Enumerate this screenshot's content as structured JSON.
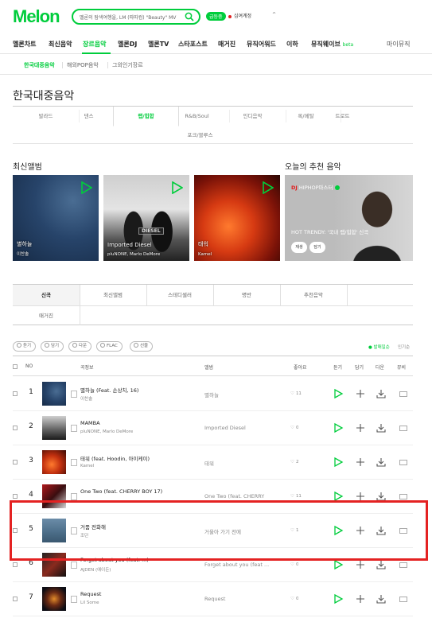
{
  "header": {
    "logo": "Melon",
    "search_placeholder": "멜론의 탐색여행을, LM (따따컴) \"Beauty\" MV",
    "event_badge": "급등중",
    "user_label": "심여계정",
    "caret": "^"
  },
  "gnb": [
    "멜론차트",
    "최신음악",
    "장르음악",
    "멜론DJ",
    "멜론TV",
    "스타포스트",
    "매거진",
    "뮤직어워드",
    "이하",
    "뮤직웨이브",
    "마이뮤직"
  ],
  "gnb_beta": "beta",
  "sub_nav": [
    "한국대중음악",
    "해외POP음악",
    "그외인기장르"
  ],
  "page_title": "한국대중음악",
  "genres": [
    "발라드",
    "댄스",
    "랩/힙합",
    "R&B/Soul",
    "인디음악",
    "록/메탈",
    "트로트",
    "포크/블루스"
  ],
  "latest_albums_title": "최신앨범",
  "recommend_title": "오늘의 추천 음악",
  "albums": [
    {
      "title": "별하늘",
      "artist": "이찬솔",
      "stamp": ""
    },
    {
      "title": "Imported Diesel",
      "artist": "pluNONE, Marlo DeMore",
      "stamp": "DIESEL"
    },
    {
      "title": "태워",
      "artist": "Kamel",
      "stamp": ""
    }
  ],
  "recommend": {
    "tag": "DJ",
    "label": "HIPHOP마스터",
    "desc": "HOT TRENDY: '국내 랩/힙합' 신곡",
    "btn1": "재생",
    "btn2": "담기"
  },
  "tabs": [
    "신곡",
    "최신앨범",
    "스테디셀러",
    "명반",
    "추천음악",
    "매거진"
  ],
  "toolbar": {
    "buttons": [
      "듣기",
      "담기",
      "다운",
      "FLAC",
      "선물"
    ],
    "sort_new": "● 발매일순",
    "sort_pop": "인기순"
  },
  "table": {
    "headers": {
      "no": "NO",
      "song": "곡정보",
      "album": "앨범",
      "like": "좋아요",
      "listen": "듣기",
      "add": "담기",
      "down": "다운",
      "mv": "뮤비"
    },
    "rows": [
      {
        "rank": "1",
        "title": "별하늘 (Feat. 손상치, 16)",
        "artist": "이찬솔",
        "album": "별하늘",
        "likes": "11"
      },
      {
        "rank": "2",
        "title": "MAMBA",
        "artist": "pluNONE, Marlo DeMore",
        "album": "Imported Diesel",
        "likes": "0"
      },
      {
        "rank": "3",
        "title": "태워 (feat. Hoodin, 아이케이)",
        "artist": "Kamel",
        "album": "태워",
        "likes": "2"
      },
      {
        "rank": "4",
        "title": "One Two (feat. CHERRY BOY 17)",
        "artist": "",
        "album": "One Two (feat. CHERRY",
        "likes": "11"
      },
      {
        "rank": "5",
        "title": "거품 전화해",
        "artist": "조던",
        "album": "거울아 가기 전에",
        "likes": "1"
      },
      {
        "rank": "6",
        "title": "Forget about you (feat. ...)",
        "artist": "AJDEN (에이든)",
        "album": "Forget about you (feat ...",
        "likes": "0"
      },
      {
        "rank": "7",
        "title": "Request",
        "artist": "Lil Some",
        "album": "Request",
        "likes": "0"
      }
    ]
  },
  "colors": {
    "accent": "#00cd3c",
    "highlight": "#e42222"
  }
}
